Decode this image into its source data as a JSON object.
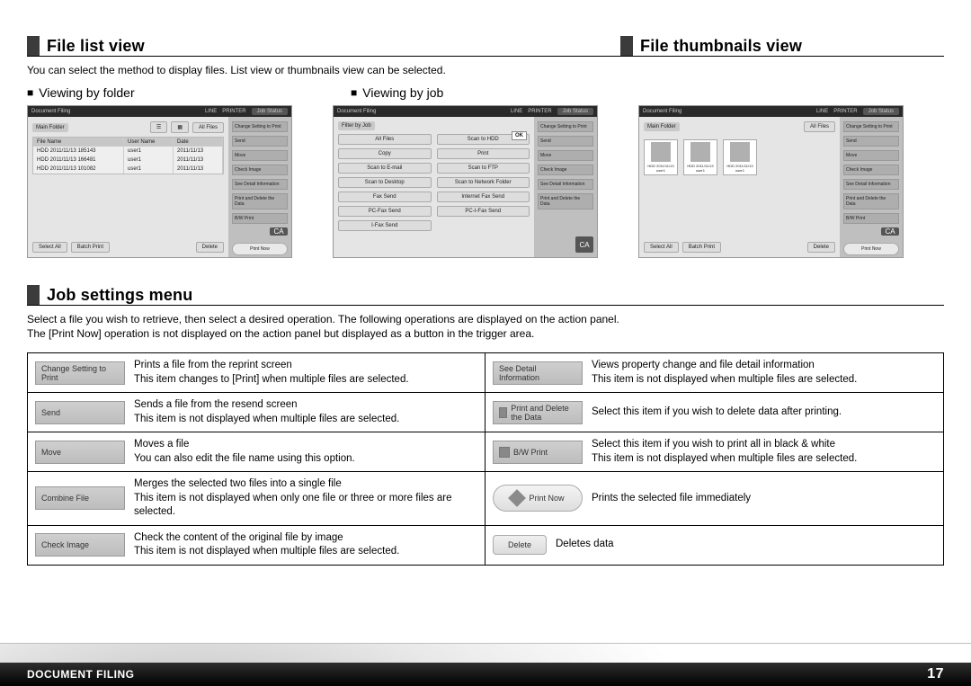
{
  "section1": {
    "h_left": "File list view",
    "h_right": "File thumbnails view",
    "intro": "You can select the method to display files. List view or thumbnails view can be selected.",
    "sub_left": "Viewing by folder",
    "sub_right": "Viewing by job"
  },
  "screens": {
    "common": {
      "app_title": "Document Filing",
      "line": "LINE",
      "printer": "PRINTER",
      "job_status": "Job Status",
      "ca": "CA",
      "select_all": "Select All",
      "batch_print": "Batch Print",
      "delete": "Delete",
      "print_now": "Print Now"
    },
    "folder": {
      "crumb": "Main Folder",
      "all_files": "All Files",
      "th_file": "File Name",
      "th_user": "User Name",
      "th_date": "Date",
      "rows": [
        {
          "f": "HDD 2011/11/13 185143",
          "u": "user1",
          "d": "2011/11/13"
        },
        {
          "f": "HDD 2011/11/13 166481",
          "u": "user1",
          "d": "2011/11/13"
        },
        {
          "f": "HDD 2011/11/13 101082",
          "u": "user1",
          "d": "2011/11/13"
        }
      ],
      "side": [
        "Change Setting to Print",
        "Send",
        "Move",
        "Check Image",
        "See Detail Information",
        "Print and Delete the Data",
        "B/W Print"
      ]
    },
    "job": {
      "crumb": "Filter by Job",
      "ok": "OK",
      "items": [
        "All Files",
        "Copy",
        "Scan to E-mail",
        "Scan to Desktop",
        "Fax Send",
        "PC-Fax Send",
        "I-Fax Send",
        "Scan to HDD",
        "Print",
        "Scan to FTP",
        "Scan to Network Folder",
        "Internet Fax Send",
        "PC-I-Fax Send"
      ],
      "side": [
        "Change Setting to Print",
        "Send",
        "Move",
        "Check Image",
        "See Detail Information",
        "Print and Delete the Data"
      ]
    },
    "thumb": {
      "crumb": "Main Folder",
      "all_files": "All Files",
      "items": [
        {
          "n": "HDD 2011/11/13",
          "u": "user1"
        },
        {
          "n": "HDD 2011/11/13",
          "u": "user1"
        },
        {
          "n": "HDD 2011/11/13",
          "u": "user1"
        }
      ],
      "side": [
        "Change Setting to Print",
        "Send",
        "Move",
        "Check Image",
        "See Detail Information",
        "Print and Delete the Data",
        "B/W Print"
      ]
    }
  },
  "section2": {
    "title": "Job settings menu",
    "p1": "Select a file you wish to retrieve, then select a desired operation. The following operations are displayed on the action panel.",
    "p2": "The [Print Now] operation is not displayed on the action panel but displayed as a button in the trigger area."
  },
  "settings": [
    {
      "label": "Change Setting to Print",
      "desc": "Prints a file from the reprint screen\nThis item changes to [Print] when multiple files are selected."
    },
    {
      "label": "See Detail Information",
      "desc": "Views property change and file detail information\nThis item is not displayed when multiple files are selected."
    },
    {
      "label": "Send",
      "desc": "Sends a file from the resend screen\nThis item is not displayed when multiple files are selected."
    },
    {
      "label": "Print and Delete the Data",
      "icon": true,
      "desc": "Select this item if you wish to delete data after printing."
    },
    {
      "label": "Move",
      "desc": "Moves a file\nYou can also edit the file name using this option."
    },
    {
      "label": "B/W Print",
      "icon": true,
      "desc": "Select this item if you wish to print all in black & white\nThis item is not displayed when multiple files are selected."
    },
    {
      "label": "Combine File",
      "desc": "Merges the selected two files into a single file\nThis item is not displayed when only one file or three or more files are selected."
    },
    {
      "label": "Print Now",
      "pill": true,
      "desc": "Prints the selected file immediately"
    },
    {
      "label": "Check Image",
      "desc": "Check the content of the original file by image\nThis item is not displayed when multiple files are selected."
    },
    {
      "label": "Delete",
      "small": true,
      "desc": "Deletes data"
    }
  ],
  "footer": {
    "title": "DOCUMENT FILING",
    "page": "17"
  }
}
